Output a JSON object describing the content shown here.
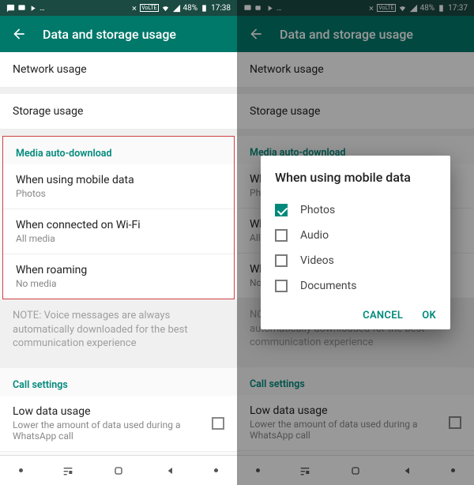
{
  "status_left": {
    "time": "17:38",
    "time2": "17:37",
    "battery": "48%"
  },
  "app": {
    "title": "Data and storage usage"
  },
  "rows": {
    "network": "Network usage",
    "storage": "Storage usage"
  },
  "section_media": "Media auto-download",
  "media": {
    "mobile": {
      "title": "When using mobile data",
      "sub": "Photos"
    },
    "wifi": {
      "title": "When connected on Wi-Fi",
      "sub": "All media"
    },
    "roaming": {
      "title": "When roaming",
      "sub": "No media"
    }
  },
  "note": "NOTE: Voice messages are always automatically downloaded for the best communication experience",
  "section_call": "Call settings",
  "lowdata": {
    "title": "Low data usage",
    "sub": "Lower the amount of data used during a WhatsApp call"
  },
  "dialog": {
    "title": "When using mobile data",
    "items": [
      {
        "label": "Photos",
        "checked": true
      },
      {
        "label": "Audio",
        "checked": false
      },
      {
        "label": "Videos",
        "checked": false
      },
      {
        "label": "Documents",
        "checked": false
      }
    ],
    "cancel": "CANCEL",
    "ok": "OK"
  }
}
